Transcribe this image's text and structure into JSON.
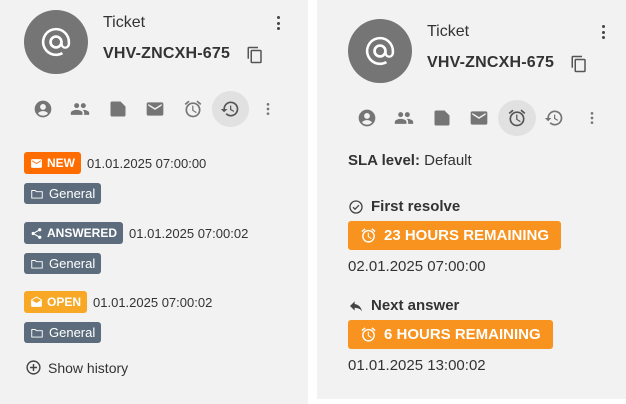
{
  "left": {
    "ticket_label": "Ticket",
    "ticket_number": "VHV-ZNCXH-675",
    "tabs": [
      "customer",
      "group",
      "tags",
      "email",
      "sla",
      "history",
      "more"
    ],
    "active_tab": "history",
    "history": [
      {
        "state": "NEW",
        "time": "01.01.2025 07:00:00",
        "group": "General",
        "color": "#ff6d00"
      },
      {
        "state": "ANSWERED",
        "time": "01.01.2025 07:00:02",
        "group": "General",
        "color": "#5d6c7c"
      },
      {
        "state": "OPEN",
        "time": "01.01.2025 07:00:02",
        "group": "General",
        "color": "#f9a825"
      }
    ],
    "show_history": "Show history"
  },
  "right": {
    "ticket_label": "Ticket",
    "ticket_number": "VHV-ZNCXH-675",
    "active_tab": "sla",
    "sla_level_label": "SLA level:",
    "sla_level_value": "Default",
    "first_resolve": {
      "title": "First resolve",
      "remaining": "23 HOURS REMAINING",
      "date": "02.01.2025 07:00:00"
    },
    "next_answer": {
      "title": "Next answer",
      "remaining": "6 HOURS REMAINING",
      "date": "01.01.2025 13:00:02"
    }
  },
  "colors": {
    "accent_orange": "#f7931e",
    "new_badge": "#ff6d00",
    "answered_badge": "#5d6c7c",
    "open_badge": "#f9a825",
    "avatar": "#757575"
  }
}
